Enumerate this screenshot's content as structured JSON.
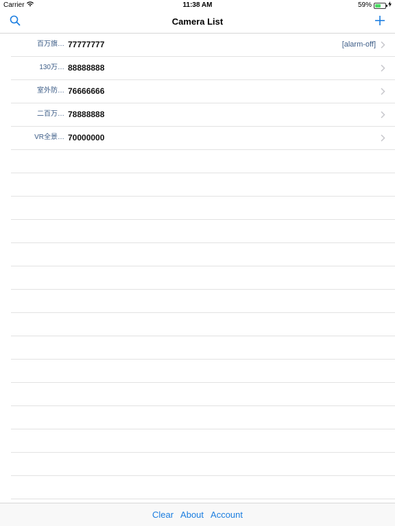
{
  "status_bar": {
    "carrier": "Carrier",
    "time": "11:38 AM",
    "battery": "59%",
    "battery_level": 0.59
  },
  "nav": {
    "title": "Camera List",
    "search_icon": "search-icon",
    "add_icon": "plus-icon"
  },
  "cameras": [
    {
      "name": "百万旗…",
      "number": "77777777",
      "status": "[alarm-off]"
    },
    {
      "name": "130万…",
      "number": "88888888",
      "status": ""
    },
    {
      "name": "室外防…",
      "number": "76666666",
      "status": ""
    },
    {
      "name": "二百万…",
      "number": "78888888",
      "status": ""
    },
    {
      "name": "VR全景…",
      "number": "70000000",
      "status": ""
    }
  ],
  "toolbar": {
    "clear": "Clear",
    "about": "About",
    "account": "Account"
  },
  "colors": {
    "accent": "#1a7de0",
    "camera_name": "#3c5c87",
    "battery_fill": "#4cd964"
  }
}
